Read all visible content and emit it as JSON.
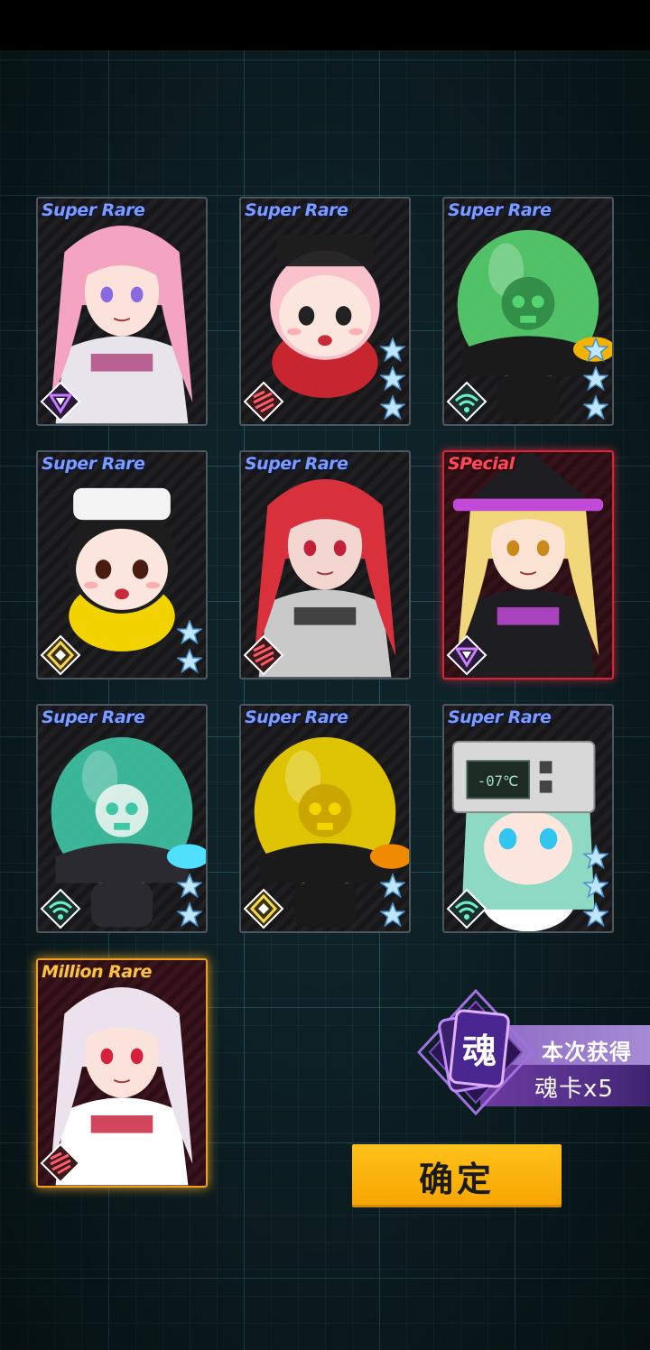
{
  "cards": [
    {
      "rarity": "Super Rare",
      "tier": "sr",
      "character": "pink-hair-girl-icon",
      "class_icon": "triangle-class-icon",
      "stars": 0
    },
    {
      "rarity": "Super Rare",
      "tier": "sr",
      "character": "chibi-pink-girl-icon",
      "class_icon": "stripes-class-icon",
      "stars": 3
    },
    {
      "rarity": "Super Rare",
      "tier": "sr",
      "character": "green-skull-jar-icon",
      "class_icon": "wifi-class-icon",
      "stars": 3
    },
    {
      "rarity": "Super Rare",
      "tier": "sr",
      "character": "chibi-yellow-hat-girl-icon",
      "class_icon": "diamond-class-icon",
      "stars": 2
    },
    {
      "rarity": "Super Rare",
      "tier": "sr",
      "character": "red-twintail-girl-icon",
      "class_icon": "stripes-class-icon",
      "stars": 0
    },
    {
      "rarity": "SPecial",
      "tier": "special",
      "character": "blonde-witch-girl-icon",
      "class_icon": "triangle-class-icon",
      "stars": 0
    },
    {
      "rarity": "Super Rare",
      "tier": "sr",
      "character": "teal-skull-ball-icon",
      "class_icon": "wifi-class-icon",
      "stars": 2
    },
    {
      "rarity": "Super Rare",
      "tier": "sr",
      "character": "yellow-skull-jar-icon",
      "class_icon": "diamond-class-icon",
      "stars": 2
    },
    {
      "rarity": "Super Rare",
      "tier": "sr",
      "character": "fridge-head-girl-icon",
      "class_icon": "wifi-class-icon",
      "stars": 3
    },
    {
      "rarity": "Million Rare",
      "tier": "million",
      "character": "white-hair-girl-icon",
      "class_icon": "stripes-class-icon",
      "stars": 0
    }
  ],
  "fridge_display": "-07℃",
  "soul_reward": {
    "icon_char": "魂",
    "title": "本次获得",
    "count": "魂卡x5"
  },
  "confirm_label": "确定",
  "colors": {
    "sr_label": "#7d9cff",
    "special_label": "#ff4a5a",
    "million_label": "#ffc04a",
    "star": "#9fd4ff",
    "confirm_button": "#f6a400",
    "soul_panel": "#6c3a9e"
  }
}
